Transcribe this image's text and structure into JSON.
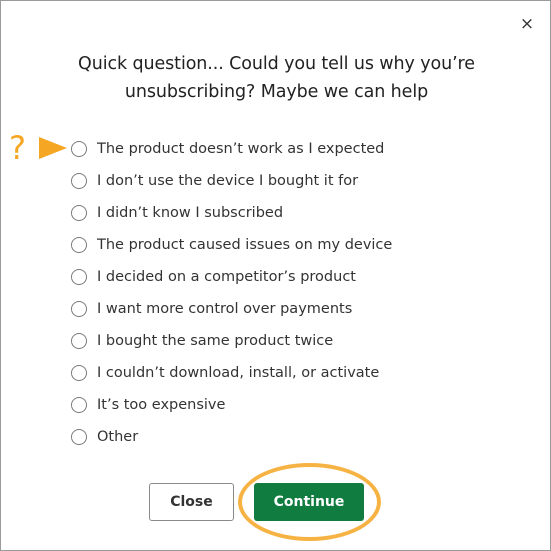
{
  "dialog": {
    "close_symbol": "×",
    "title": "Quick question... Could you tell us why you’re unsubscribing? Maybe we can help"
  },
  "hint": {
    "symbol": "?",
    "accent_color": "#f5a623",
    "icon": "arrow-right-icon"
  },
  "options": [
    {
      "label": "The product doesn’t work as I expected"
    },
    {
      "label": "I don’t use the device I bought it for"
    },
    {
      "label": "I didn’t know I subscribed"
    },
    {
      "label": "The product caused issues on my device"
    },
    {
      "label": "I decided on a competitor’s product"
    },
    {
      "label": "I want more control over payments"
    },
    {
      "label": "I bought the same product twice"
    },
    {
      "label": "I couldn’t download, install, or activate"
    },
    {
      "label": "It’s too expensive"
    },
    {
      "label": "Other"
    }
  ],
  "buttons": {
    "close_label": "Close",
    "continue_label": "Continue",
    "continue_color": "#117c40"
  }
}
